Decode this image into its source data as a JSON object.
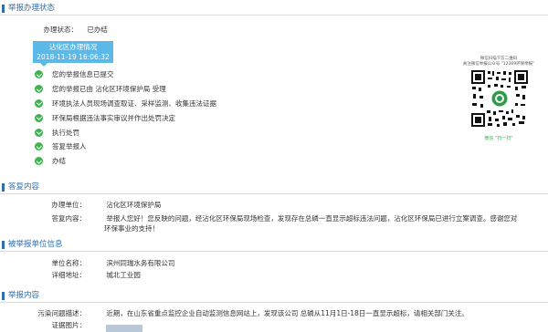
{
  "sections": {
    "status": "举报办理状态",
    "reply": "答复内容",
    "reported_unit": "被举报单位信息",
    "report_content": "举报内容"
  },
  "status": {
    "label": "办理状态：",
    "value": "已办结"
  },
  "timeline": {
    "box_title": "沾化区办理情况",
    "box_date": "2018-11-19 16:06:32",
    "steps": [
      "您的举报信息已提交",
      "您的举报已由 沾化区环境保护局 受理",
      "环境执法人员现场调查取证、采样监测、收集违法证据",
      "环保局根据违法事实审议并作出处罚决定",
      "执行处罚",
      "答复举报人",
      "办结"
    ],
    "check_color": "#3fb34f",
    "box_color": "#5cb8e6"
  },
  "qr": {
    "caption_line1": "微信扫描下方二维码",
    "caption_line2": "关注微信举报公众号 \"12369环保举报\"",
    "caption_bottom": "微信 \"扫一扫\"",
    "icon": "qr-code-icon"
  },
  "reply": {
    "unit_label": "办理单位：",
    "unit_value": "沾化区环境保护局",
    "content_label": "答复内容：",
    "content_line1": "举报人您好！您反映的问题，经沾化区环保局现场检查，发现存在总磷一直显示超标违法问题，沾化区环保局已进行立案调查。感谢您对",
    "content_line2": "环保事业的支持！"
  },
  "reported_unit": {
    "name_label": "单位名称：",
    "name_value": "滨州同瑞水务有限公司",
    "address_label": "详细地址：",
    "address_value": "城北工业园"
  },
  "report_content": {
    "desc_label": "污染问题描述：",
    "desc_value": "近期，在山东省重点监控企业自动监测信息网站上，发现该公司 总磷从11月1日-18日一直显示超标，请相关部门关注。",
    "photo_label": "证据图片："
  },
  "colors": {
    "accent": "#2f6fb0",
    "success": "#3fb34f"
  }
}
